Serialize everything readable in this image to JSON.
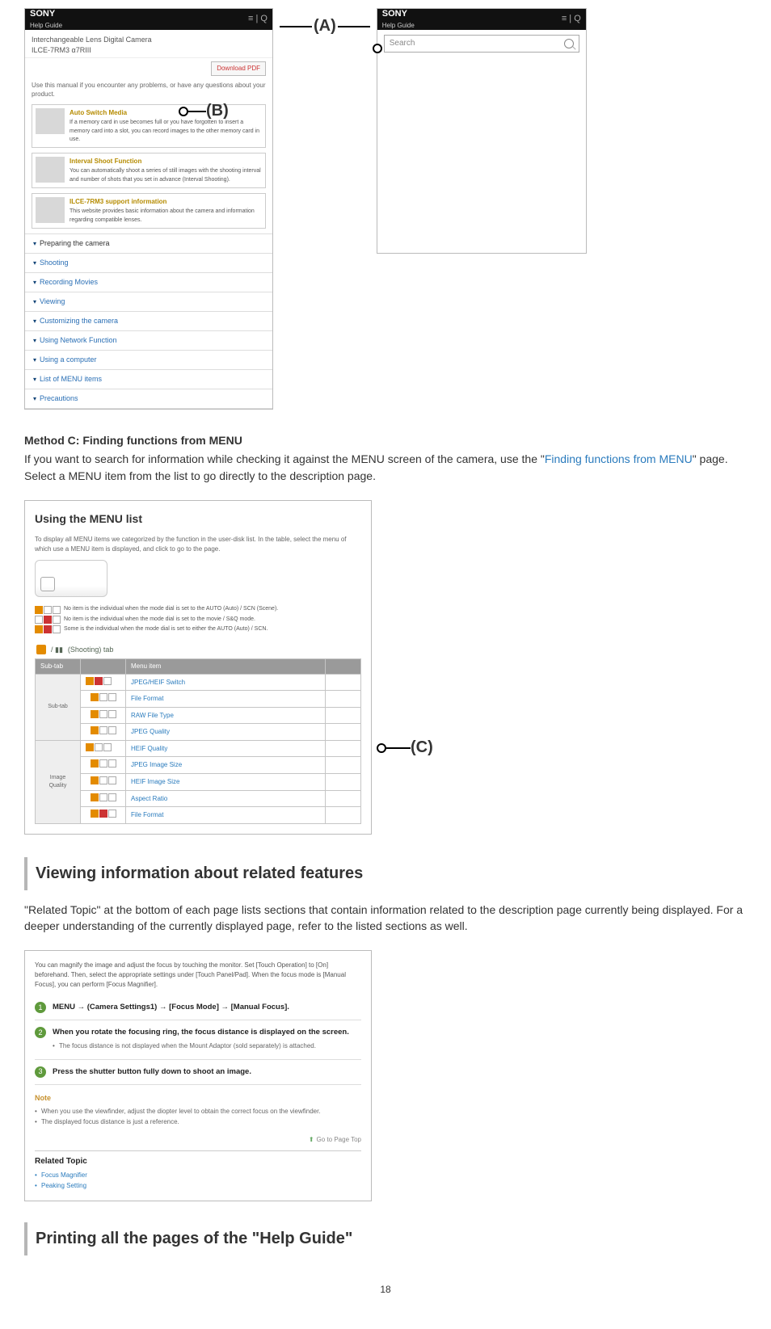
{
  "top": {
    "leftBar": {
      "brand": "SONY",
      "sub": "Help Guide",
      "icons": "≡  | Q"
    },
    "rightBar": {
      "brand": "SONY",
      "sub": "Help Guide",
      "icons": "≡  | Q"
    },
    "subtitle": "Interchangeable Lens Digital Camera\nILCE-7RM3  α7RIII",
    "download": "Download PDF",
    "intro": "Use this manual if you encounter any problems, or have any questions about your product.",
    "cards": [
      {
        "title": "Auto Switch Media",
        "text": "If a memory card in use becomes full or you have forgotten to insert a memory card into a slot, you can record images to the other memory card in use."
      },
      {
        "title": "Interval Shoot Function",
        "text": "You can automatically shoot a series of still images with the shooting interval and number of shots that you set in advance (Interval Shooting)."
      },
      {
        "title": "ILCE-7RM3 support information",
        "text": "This website provides basic information about the camera and information regarding compatible lenses."
      }
    ],
    "accordion": [
      "Preparing the camera",
      "Shooting",
      "Recording Movies",
      "Viewing",
      "Customizing the camera",
      "Using Network Function",
      "Using a computer",
      "List of MENU items",
      "Precautions"
    ],
    "labelA": "(A)",
    "labelB": "(B)",
    "search": {
      "placeholder": "Search"
    }
  },
  "methodC": {
    "heading": "Method C: Finding functions from MENU",
    "text1": "If you want to search for information while checking it against the MENU screen of the camera, use the \"",
    "link": "Finding functions from MENU",
    "text2": "\" page. Select a MENU item from the list to go directly to the description page."
  },
  "mid": {
    "title": "Using the MENU list",
    "intro": "To display all MENU items we categorized by the function in the user-disk list. In the table, select the menu of which use a MENU item is displayed, and click to go to the page.",
    "tagLines": [
      "No item is the individual when the mode dial is set to the AUTO (Auto) / SCN (Scene).",
      "No item is the individual when the mode dial is set to the movie / S&Q mode.",
      "Some is the individual when the mode dial is set to either the AUTO (Auto) / SCN."
    ],
    "tabLabel": "(Shooting) tab",
    "table": {
      "headers": [
        "Sub-tab",
        "",
        "Menu item",
        ""
      ],
      "leftGroups": [
        "Sub-tab",
        "Image Quality"
      ],
      "rows": [
        {
          "link": "JPEG/HEIF Switch"
        },
        {
          "link": "File Format"
        },
        {
          "link": "RAW File Type"
        },
        {
          "link": "JPEG Quality"
        },
        {
          "link": "HEIF Quality"
        },
        {
          "link": "JPEG Image Size"
        },
        {
          "link": "HEIF Image Size"
        },
        {
          "link": "Aspect Ratio"
        },
        {
          "link": "File Format"
        }
      ]
    },
    "labelC": "(C)"
  },
  "viewSection": {
    "heading": "Viewing information about related features",
    "para": "\"Related Topic\" at the bottom of each page lists sections that contain information related to the description page currently being displayed. For a deeper understanding of the currently displayed page, refer to the listed sections as well."
  },
  "bot": {
    "lead": "You can magnify the image and adjust the focus by touching the monitor. Set [Touch Operation] to [On] beforehand. Then, select the appropriate settings under [Touch Panel/Pad]. When the focus mode is [Manual Focus], you can perform [Focus Magnifier].",
    "steps": [
      {
        "n": "1",
        "bold": "MENU → (Camera Settings1) → [Focus Mode] → [Manual Focus].",
        "extra": ""
      },
      {
        "n": "2",
        "bold": "When you rotate the focusing ring, the focus distance is displayed on the screen.",
        "extra": "The focus distance is not displayed when the Mount Adaptor (sold separately) is attached."
      },
      {
        "n": "3",
        "bold": "Press the shutter button fully down to shoot an image.",
        "extra": ""
      }
    ],
    "noteH": "Note",
    "notes": [
      "When you use the viewfinder, adjust the diopter level to obtain the correct focus on the viewfinder.",
      "The displayed focus distance is just a reference."
    ],
    "pgTop": "Go to Page Top",
    "relatedH": "Related Topic",
    "related": [
      "Focus Magnifier",
      "Peaking Setting"
    ]
  },
  "printSection": {
    "heading": "Printing all the pages of the \"Help Guide\""
  },
  "pageNum": "18"
}
